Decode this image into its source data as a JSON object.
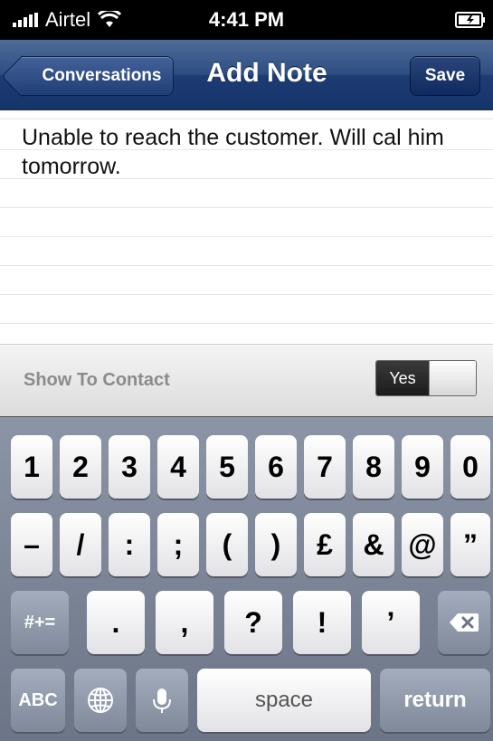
{
  "status_bar": {
    "carrier": "Airtel",
    "time": "4:41 PM"
  },
  "nav_bar": {
    "back_label": "Conversations",
    "title": "Add Note",
    "save_label": "Save",
    "color": "#1d3c73"
  },
  "note": {
    "text": "Unable to reach the customer. Will cal him tomorrow."
  },
  "contact_setting": {
    "label": "Show To Contact",
    "toggle_label": "Yes",
    "toggle_on": true
  },
  "keyboard": {
    "row1": [
      "1",
      "2",
      "3",
      "4",
      "5",
      "6",
      "7",
      "8",
      "9",
      "0"
    ],
    "row2": [
      "–",
      "/",
      ":",
      ";",
      "(",
      ")",
      "£",
      "&",
      "@",
      "”"
    ],
    "row3": [
      "#+=",
      ".",
      ",",
      "?",
      "!",
      "’"
    ],
    "row4": [
      "ABC",
      "space",
      "return"
    ],
    "icons": [
      "backspace-icon",
      "globe-icon",
      "microphone-icon"
    ]
  }
}
